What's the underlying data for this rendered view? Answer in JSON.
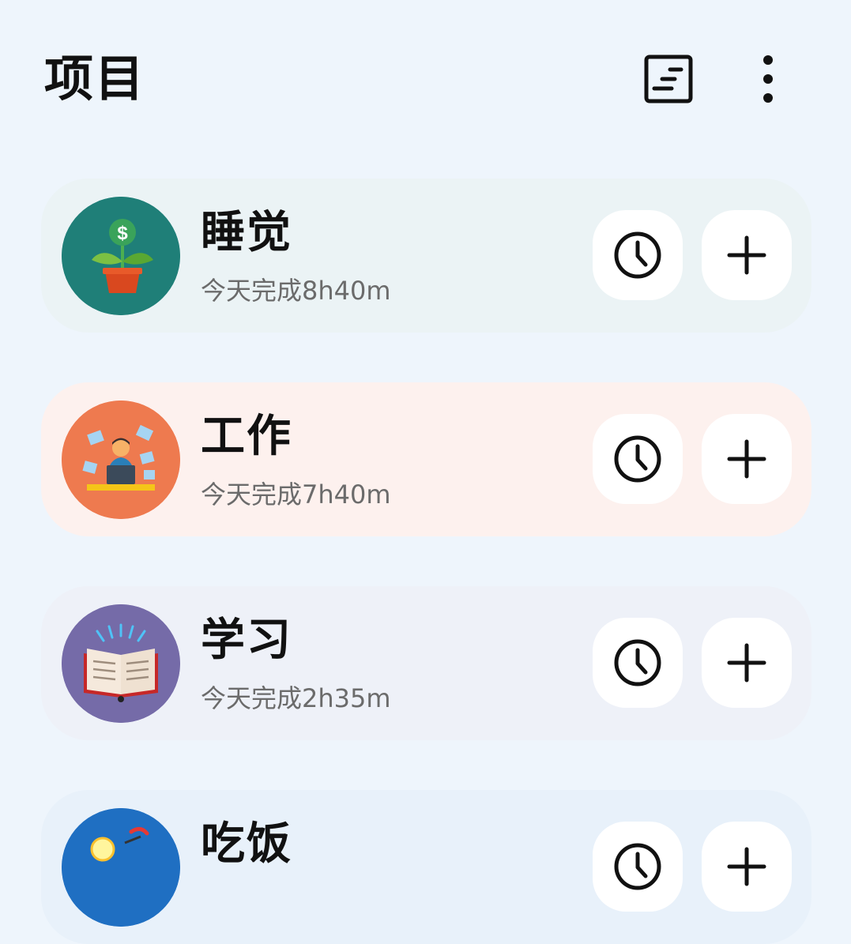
{
  "header": {
    "title": "项目",
    "sort_icon": "sort-list-icon",
    "more_icon": "more-vertical-icon"
  },
  "projects": [
    {
      "name": "睡觉",
      "subtitle": "今天完成8h40m",
      "icon": "money-plant-icon",
      "avatar_color": "#1f7f78",
      "card_color": "#ebf3f5"
    },
    {
      "name": "工作",
      "subtitle": "今天完成7h40m",
      "icon": "office-worker-icon",
      "avatar_color": "#ee7a4f",
      "card_color": "#fdf1ee"
    },
    {
      "name": "学习",
      "subtitle": "今天完成2h35m",
      "icon": "open-book-icon",
      "avatar_color": "#756ba8",
      "card_color": "#eef1f8"
    },
    {
      "name": "吃饭",
      "subtitle": "",
      "icon": "food-icon",
      "avatar_color": "#1f6fc2",
      "card_color": "#e8f1fa"
    }
  ],
  "actions": {
    "timer_icon": "clock-icon",
    "add_icon": "plus-icon"
  }
}
